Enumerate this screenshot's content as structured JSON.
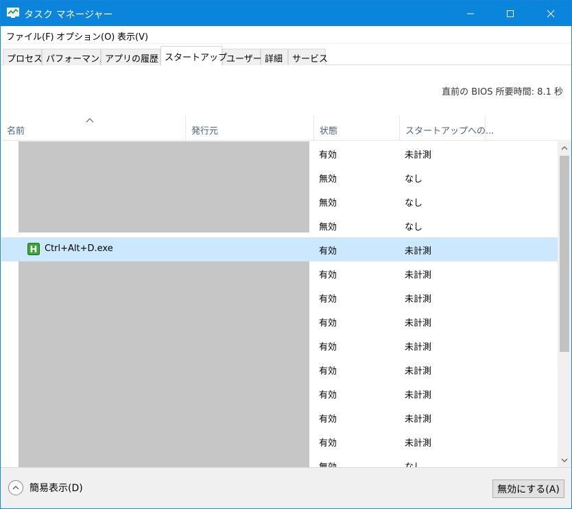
{
  "window": {
    "title": "タスク マネージャー"
  },
  "menu": [
    "ファイル(F)",
    "オプション(O)",
    "表示(V)"
  ],
  "tabs": [
    "プロセス",
    "パフォーマンス",
    "アプリの履歴",
    "スタートアップ",
    "ユーザー",
    "詳細",
    "サービス"
  ],
  "active_tab": "スタートアップ",
  "bios_time": "直前の BIOS 所要時間:  8.1 秒",
  "columns": [
    "名前",
    "発行元",
    "状態",
    "スタートアップへの..."
  ],
  "rows": [
    {
      "name": "",
      "status": "有効",
      "impact": "未計測"
    },
    {
      "name": "",
      "status": "無効",
      "impact": "なし"
    },
    {
      "name": "",
      "status": "無効",
      "impact": "なし"
    },
    {
      "name": "",
      "status": "無効",
      "impact": "なし"
    },
    {
      "name": "Ctrl+Alt+D.exe",
      "status": "有効",
      "impact": "未計測",
      "selected": true
    },
    {
      "name": "",
      "status": "有効",
      "impact": "未計測"
    },
    {
      "name": "",
      "status": "有効",
      "impact": "未計測"
    },
    {
      "name": "",
      "status": "有効",
      "impact": "未計測"
    },
    {
      "name": "",
      "status": "有効",
      "impact": "未計測"
    },
    {
      "name": "",
      "status": "有効",
      "impact": "未計測"
    },
    {
      "name": "",
      "status": "有効",
      "impact": "未計測"
    },
    {
      "name": "",
      "status": "有効",
      "impact": "未計測"
    },
    {
      "name": "",
      "status": "有効",
      "impact": "未計測"
    },
    {
      "name": "",
      "status": "無効",
      "impact": "なし"
    }
  ],
  "footer": {
    "fewer_details": "簡易表示(D)",
    "disable_button": "無効にする(A)"
  },
  "colors": {
    "titlebar": "#0b84dc",
    "selection": "#cce8ff",
    "redaction": "#c6c6c6"
  }
}
